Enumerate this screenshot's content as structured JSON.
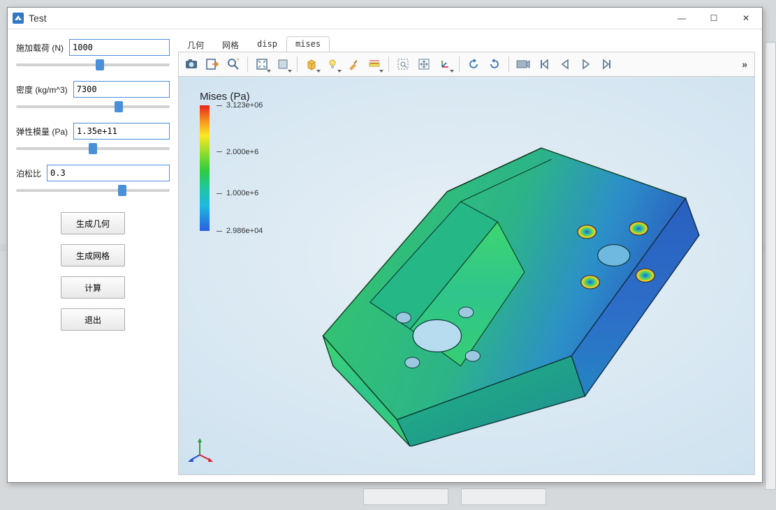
{
  "window": {
    "title": "Test"
  },
  "window_controls": {
    "min": "—",
    "max": "☐",
    "close": "✕"
  },
  "params": {
    "load": {
      "label": "施加载荷 (N)",
      "value": "1000",
      "slider": 55
    },
    "density": {
      "label": "密度 (kg/m^3)",
      "value": "7300",
      "slider": 68
    },
    "modulus": {
      "label": "弹性模量 (Pa)",
      "value": "1.35e+11",
      "slider": 50
    },
    "poisson": {
      "label": "泊松比",
      "value": "0.3",
      "slider": 70
    }
  },
  "buttons": {
    "gen_geometry": "生成几何",
    "gen_mesh": "生成网格",
    "compute": "计算",
    "exit": "退出"
  },
  "tabs": [
    "几何",
    "网格",
    "disp",
    "mises"
  ],
  "active_tab": 3,
  "legend": {
    "title": "Mises (Pa)",
    "ticks": [
      {
        "pos": 0,
        "label": "3.123e+06"
      },
      {
        "pos": 37,
        "label": "2.000e+6"
      },
      {
        "pos": 70,
        "label": "1.000e+6"
      },
      {
        "pos": 100,
        "label": "2.986e+04"
      }
    ]
  },
  "toolbar_overflow": "»",
  "chart_data": {
    "type": "colorbar",
    "title": "Mises (Pa)",
    "min": 29860.0,
    "max": 3123000.0,
    "ticks": [
      3123000.0,
      2000000.0,
      1000000.0,
      29860.0
    ],
    "colormap": [
      "#2a5fe0",
      "#1fb8e0",
      "#1fc6a0",
      "#2ecc40",
      "#8fdc2e",
      "#fde725",
      "#f78f1e",
      "#e8231a"
    ]
  }
}
